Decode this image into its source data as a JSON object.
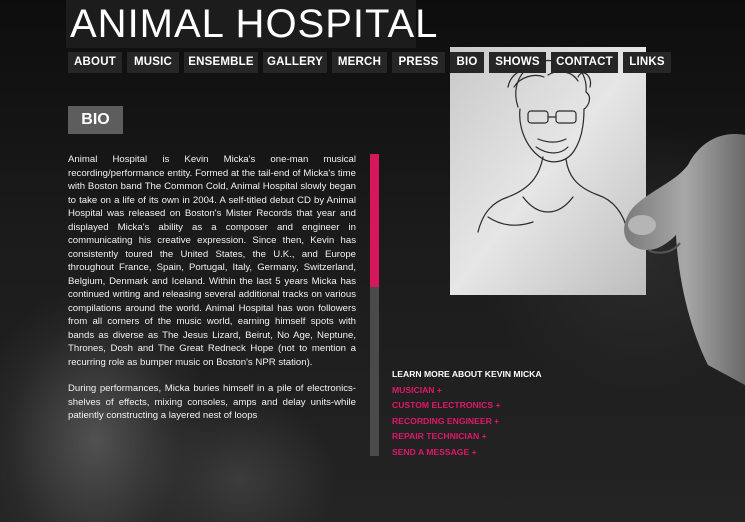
{
  "site": {
    "title": "ANIMAL HOSPITAL"
  },
  "nav": {
    "items": [
      {
        "label": "ABOUT"
      },
      {
        "label": "MUSIC"
      },
      {
        "label": "ENSEMBLE"
      },
      {
        "label": "GALLERY"
      },
      {
        "label": "MERCH"
      },
      {
        "label": "PRESS"
      },
      {
        "label": "BIO"
      },
      {
        "label": "SHOWS"
      },
      {
        "label": "CONTACT"
      },
      {
        "label": "LINKS"
      }
    ]
  },
  "page": {
    "heading": "BIO"
  },
  "bio": {
    "paragraphs": [
      "Animal Hospital is Kevin Micka's one-man musical recording/performance entity. Formed at the tail-end of Micka's time with Boston band The Common Cold, Animal Hospital slowly began to take on a life of its own in 2004. A self-titled debut CD by Animal Hospital was released on Boston's Mister Records that year and displayed Micka's ability as a composer and engineer in communicating his creative expression. Since then, Kevin has consistently toured the United States, the U.K., and Europe throughout France, Spain, Portugal, Italy, Germany, Switzerland, Belgium, Denmark and Iceland. Within the last 5 years Micka has continued writing and releasing several additional tracks on various compilations around the world. Animal Hospital has won followers from all corners of the music world, earning himself spots with bands as diverse as The Jesus Lizard, Beirut, No Age, Neptune, Thrones, Dosh and The Great Redneck Hope (not to mention a recurring role as bumper music on Boston's NPR station).",
      "During performances, Micka buries himself in a pile of electronics-shelves of effects, mixing consoles, amps and delay units-while patiently constructing a layered nest of loops"
    ]
  },
  "learn_more": {
    "title": "LEARN MORE ABOUT KEVIN MICKA",
    "links": [
      {
        "label": "MUSICIAN +"
      },
      {
        "label": "CUSTOM ELECTRONICS +"
      },
      {
        "label": "RECORDING ENGINEER +"
      },
      {
        "label": "REPAIR TECHNICIAN +"
      },
      {
        "label": "SEND A MESSAGE +"
      }
    ]
  },
  "colors": {
    "accent": "#e0186a",
    "scroll_thumb": "#d6175c",
    "nav_bg": "#262626",
    "heading_bg": "#5d5d5d"
  },
  "scroll": {
    "position_fraction": 0.0,
    "visible_fraction": 0.44
  }
}
